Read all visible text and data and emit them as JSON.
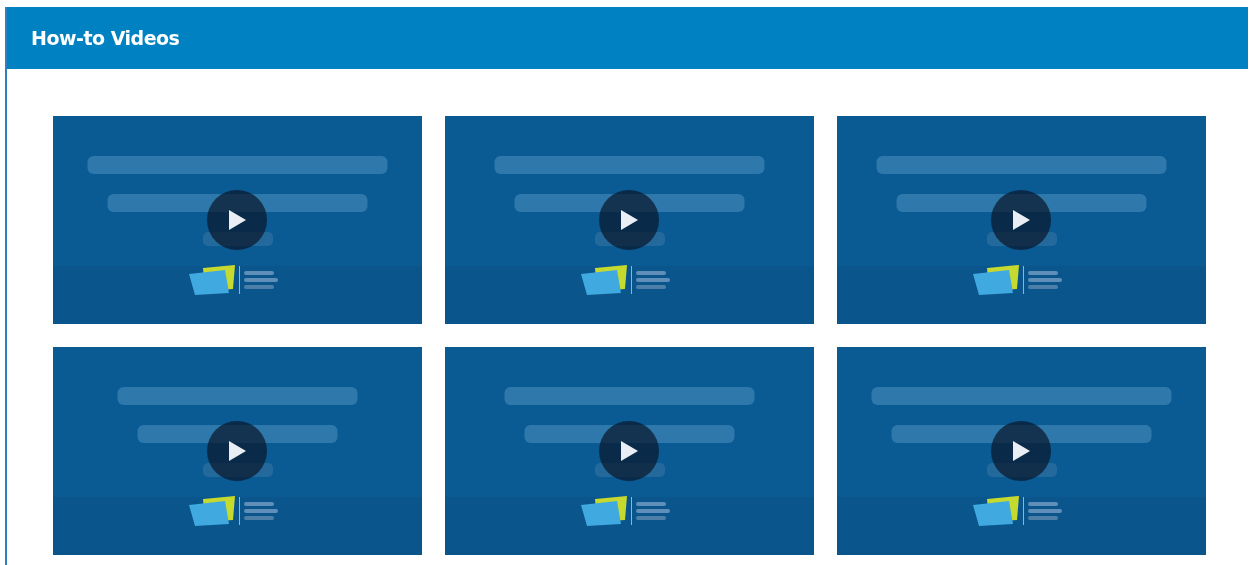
{
  "panel": {
    "title": "How-to Videos"
  }
}
